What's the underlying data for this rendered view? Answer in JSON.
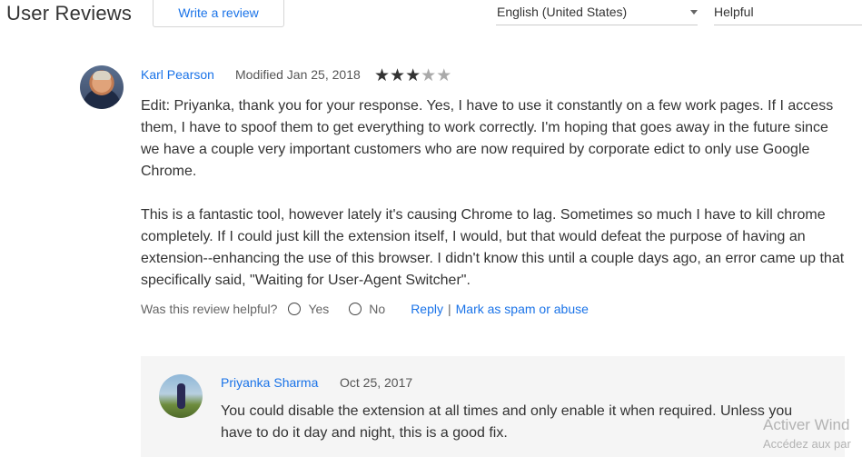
{
  "header": {
    "title": "User Reviews",
    "write_review_label": "Write a review",
    "language": "English (United States)",
    "sort": "Helpful"
  },
  "review": {
    "author": "Karl Pearson",
    "date": "Modified Jan 25, 2018",
    "rating": 3,
    "rating_max": 5,
    "paragraphs": [
      "Edit: Priyanka, thank you for your response. Yes, I have to use it constantly on a few work pages. If I access them, I have to spoof them to get everything to work correctly. I'm hoping that goes away in the future since we have a couple very important customers who are now required by corporate edict to only use Google Chrome.",
      "This is a fantastic tool, however lately it's causing Chrome to lag. Sometimes so much I have to kill chrome completely. If I could just kill the extension itself, I would, but that would defeat the purpose of having an extension--enhancing the use of this browser. I didn't know this until a couple days ago, an error came up that specifically said, \"Waiting for User-Agent Switcher\"."
    ],
    "helpful_prompt": "Was this review helpful?",
    "yes_label": "Yes",
    "no_label": "No",
    "reply_label": "Reply",
    "separator": "|",
    "spam_label": "Mark as spam or abuse"
  },
  "reply": {
    "author": "Priyanka Sharma",
    "date": "Oct 25, 2017",
    "text": "You could disable the extension at all times and only enable it when required. Unless you have to do it day and night, this is a good fix."
  },
  "watermark": {
    "line1": "Activer Wind",
    "line2": "Accédez aux par"
  },
  "colors": {
    "link": "#1a73e8",
    "reply_background": "#f5f5f5"
  },
  "icons": {
    "star_filled": "star-icon",
    "dropdown": "chevron-down-icon"
  }
}
